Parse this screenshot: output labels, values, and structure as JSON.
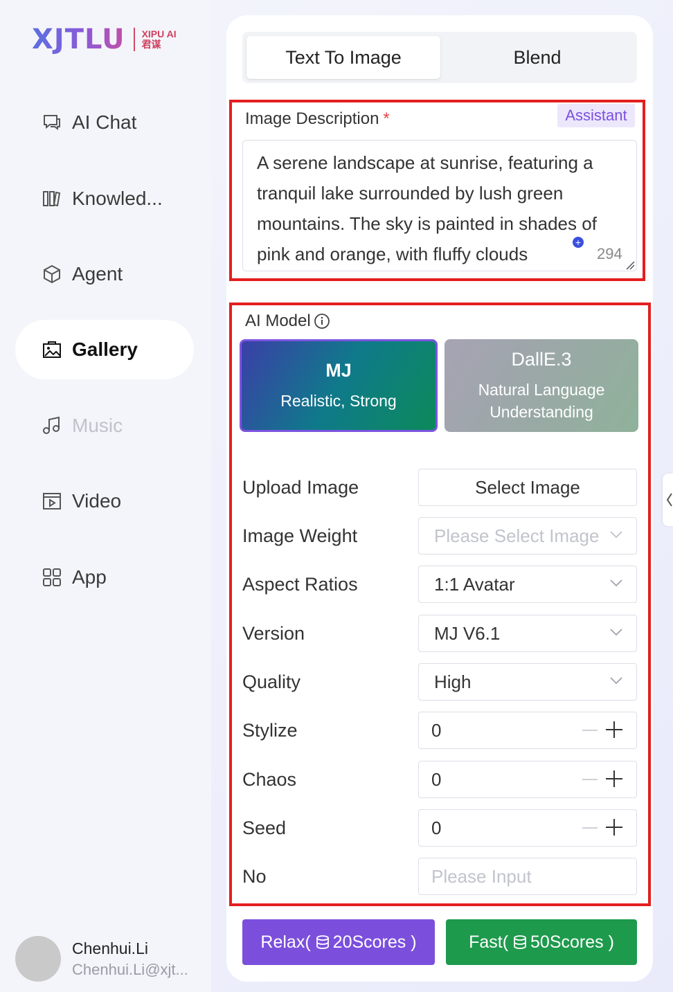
{
  "logo": {
    "main": "XJTLU",
    "sub_line1": "XIPU AI",
    "sub_line2": "君谋"
  },
  "sidebar": {
    "items": [
      {
        "label": "AI Chat",
        "icon": "chat-icon",
        "state": "normal"
      },
      {
        "label": "Knowled...",
        "icon": "books-icon",
        "state": "normal"
      },
      {
        "label": "Agent",
        "icon": "cube-icon",
        "state": "normal"
      },
      {
        "label": "Gallery",
        "icon": "gallery-icon",
        "state": "active"
      },
      {
        "label": "Music",
        "icon": "music-icon",
        "state": "disabled"
      },
      {
        "label": "Video",
        "icon": "video-icon",
        "state": "normal"
      },
      {
        "label": "App",
        "icon": "apps-icon",
        "state": "normal"
      }
    ]
  },
  "user": {
    "name": "Chenhui.Li",
    "email": "Chenhui.Li@xjt..."
  },
  "tabs": [
    {
      "label": "Text To Image",
      "active": true
    },
    {
      "label": "Blend",
      "active": false
    }
  ],
  "description": {
    "label": "Image Description",
    "required_mark": "*",
    "assistant_label": "Assistant",
    "value": "A serene landscape at sunrise, featuring a tranquil lake surrounded by lush green mountains. The sky is painted in shades of pink and orange, with fluffy clouds",
    "plus_glyph": "+",
    "char_count": "294"
  },
  "model": {
    "label": "AI Model",
    "options": [
      {
        "name": "MJ",
        "desc": "Realistic, Strong",
        "selected": true
      },
      {
        "name": "DallE.3",
        "desc": "Natural Language Understanding",
        "selected": false
      }
    ]
  },
  "form": {
    "upload_label": "Upload Image",
    "upload_button": "Select Image",
    "weight_label": "Image Weight",
    "weight_placeholder": "Please Select Image",
    "aspect_label": "Aspect Ratios",
    "aspect_value": "1:1 Avatar",
    "version_label": "Version",
    "version_value": "MJ V6.1",
    "quality_label": "Quality",
    "quality_value": "High",
    "stylize_label": "Stylize",
    "stylize_value": "0",
    "chaos_label": "Chaos",
    "chaos_value": "0",
    "seed_label": "Seed",
    "seed_value": "0",
    "no_label": "No",
    "no_placeholder": "Please Input"
  },
  "actions": {
    "relax_prefix": "Relax(",
    "relax_scores": "20Scores )",
    "fast_prefix": "Fast(",
    "fast_scores": "50Scores )"
  },
  "colors": {
    "accent_purple": "#7b4fdc",
    "fast_green": "#1e9a4d",
    "highlight_red": "#e41e1e"
  }
}
